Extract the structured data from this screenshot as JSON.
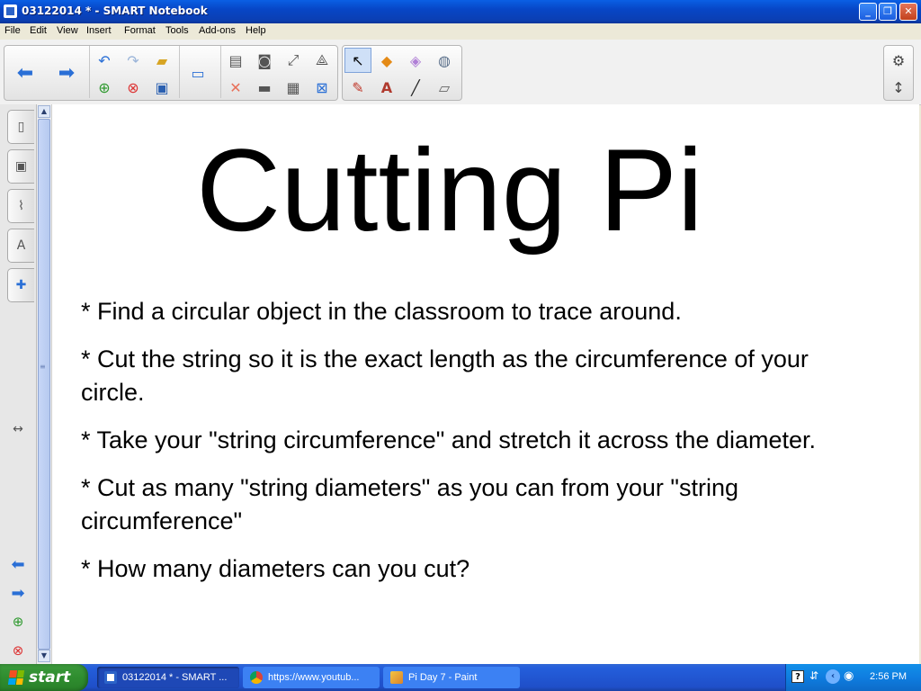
{
  "window": {
    "title": "03122014 * - SMART Notebook"
  },
  "menu": [
    "File",
    "Edit",
    "View",
    "Insert",
    "Format",
    "Tools",
    "Add-ons",
    "Help"
  ],
  "toolbar_icons": [
    "back-arrow-icon",
    "forward-arrow-icon",
    "undo-icon",
    "redo-icon",
    "open-folder-icon",
    "add-page-icon",
    "delete-page-icon",
    "save-icon",
    "display-screen-icon",
    "paste-icon",
    "screen-capture-icon",
    "full-screen-icon",
    "measurement-tools-icon",
    "delete-icon",
    "screen-shade-icon",
    "table-icon",
    "clear-page-icon",
    "select-icon",
    "shapes-icon",
    "eraser-pen-icon",
    "fill-icon",
    "pens-icon",
    "text-icon",
    "lines-icon",
    "eraser-icon",
    "settings-gear-icon",
    "move-toolbar-icon"
  ],
  "side_tabs": [
    "page-sorter-icon",
    "gallery-icon",
    "attachments-icon",
    "properties-icon",
    "add-ons-icon"
  ],
  "slide": {
    "title": "Cutting Pi",
    "bullets": [
      "* Find a circular object in the classroom to trace around.",
      "* Cut the string so it is the exact length as the circumference of your circle.",
      "* Take your \"string circumference\" and stretch it across the diameter.",
      "* Cut as many \"string diameters\" as you can from your \"string circumference\"",
      "* How many diameters can you cut?"
    ]
  },
  "taskbar": {
    "start_label": "start",
    "tasks": [
      {
        "label": "03122014 * - SMART ...",
        "active": true
      },
      {
        "label": "https://www.youtub...",
        "active": false
      },
      {
        "label": "Pi Day 7 - Paint",
        "active": false
      }
    ],
    "clock": "2:56 PM"
  },
  "colors": {
    "titlebar": "#0746c6",
    "taskbar": "#245edb",
    "start_button": "#2f8d2f",
    "arrow_blue": "#2a6fd6"
  }
}
